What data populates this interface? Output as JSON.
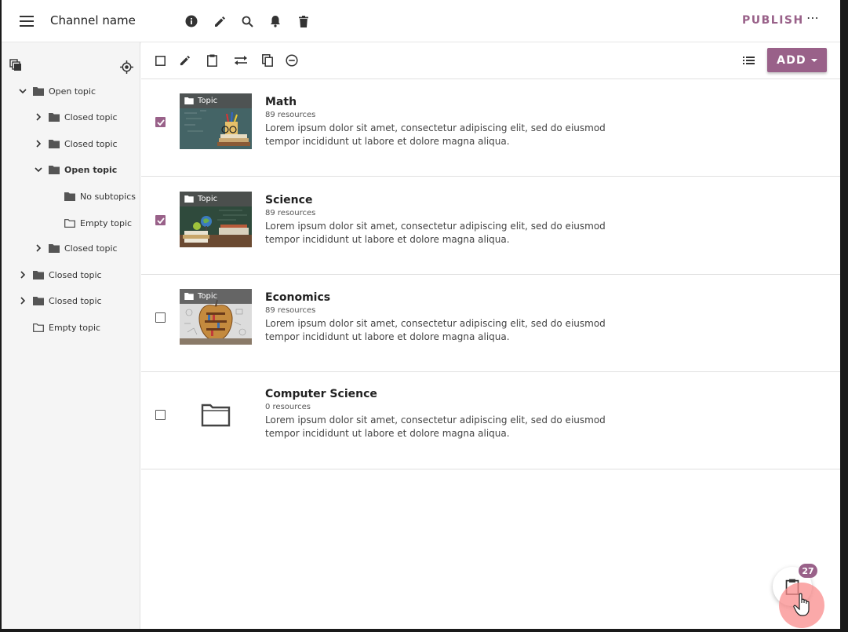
{
  "header": {
    "menu_icon": "hamburger-menu-icon",
    "title": "Channel name",
    "icons": [
      "info-icon",
      "edit-icon",
      "search-icon",
      "notifications-icon",
      "delete-icon"
    ],
    "publish_label": "PUBLISH",
    "more_label": "⋯"
  },
  "sidebar": {
    "collapse_icon": "collapse-all-icon",
    "locate_icon": "locate-icon",
    "items": [
      {
        "label": "Open topic",
        "state": "open",
        "folder": "filled"
      },
      {
        "label": "Closed topic",
        "state": "closed",
        "folder": "filled"
      },
      {
        "label": "Closed topic",
        "state": "closed",
        "folder": "filled"
      },
      {
        "label": "Open topic",
        "state": "open",
        "folder": "filled",
        "bold": true
      },
      {
        "label": "No subtopics",
        "state": "none",
        "folder": "filled"
      },
      {
        "label": "Empty topic",
        "state": "none",
        "folder": "outline"
      },
      {
        "label": "Closed topic",
        "state": "closed",
        "folder": "filled"
      },
      {
        "label": "Closed topic",
        "state": "closed",
        "folder": "filled"
      },
      {
        "label": "Closed topic",
        "state": "closed",
        "folder": "filled"
      },
      {
        "label": "Empty topic",
        "state": "none",
        "folder": "outline"
      }
    ]
  },
  "toolbar": {
    "icons": [
      "select-all-checkbox-icon",
      "edit-icon",
      "clipboard-icon",
      "move-icon",
      "copy-icon",
      "remove-icon"
    ],
    "view_icon": "list-view-icon",
    "add_label": "ADD"
  },
  "topics": [
    {
      "name": "Math",
      "count": "89 resources",
      "tag": "Topic",
      "checked": true,
      "desc": "Lorem ipsum dolor sit amet, consectetur adipiscing elit, sed do eiusmod tempor incididunt ut labore et dolore magna aliqua."
    },
    {
      "name": "Science",
      "count": "89 resources",
      "tag": "Topic",
      "checked": true,
      "desc": "Lorem ipsum dolor sit amet, consectetur adipiscing elit, sed do eiusmod tempor incididunt ut labore et dolore magna aliqua."
    },
    {
      "name": "Economics",
      "count": "89 resources",
      "tag": "Topic",
      "checked": false,
      "desc": "Lorem ipsum dolor sit amet, consectetur adipiscing elit, sed do eiusmod tempor incididunt ut labore et dolore magna aliqua."
    },
    {
      "name": "Computer Science",
      "count": "0 resources",
      "tag": "",
      "checked": false,
      "desc": "Lorem ipsum dolor sit amet, consectetur adipiscing elit, sed do eiusmod tempor incididunt ut labore et dolore magna aliqua."
    }
  ],
  "clipboard": {
    "count": "27",
    "icon": "clipboard-icon"
  },
  "colors": {
    "accent": "#996189",
    "touch": "#fa8c8c"
  }
}
